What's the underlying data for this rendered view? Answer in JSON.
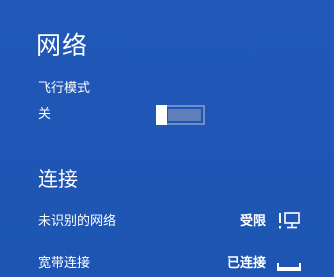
{
  "panel": {
    "title": "网络",
    "airplane_mode": {
      "label": "飞行模式",
      "state": "关",
      "on": false
    },
    "connections": {
      "title": "连接",
      "items": [
        {
          "name": "未识别的网络",
          "status": "受限",
          "icon": "network-limited-icon"
        },
        {
          "name": "宽带连接",
          "status": "已连接",
          "icon": "broadband-icon"
        }
      ]
    }
  }
}
